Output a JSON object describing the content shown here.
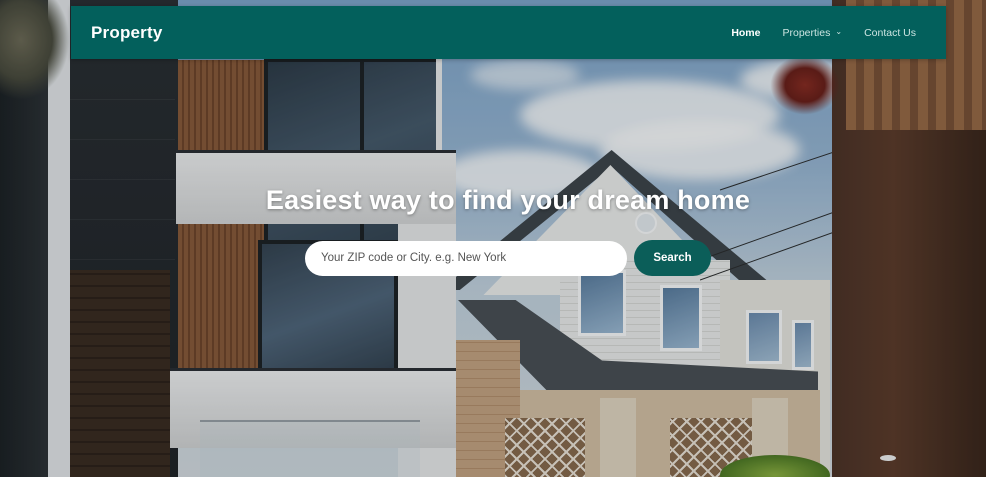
{
  "navbar": {
    "brand": "Property",
    "links": [
      {
        "label": "Home",
        "active": true
      },
      {
        "label": "Properties",
        "dropdown": true,
        "caret_icon": "chevron-down-icon"
      },
      {
        "label": "Contact Us"
      }
    ],
    "background_color": "#03605c"
  },
  "hero": {
    "title": "Easiest way to find your dream home",
    "search": {
      "placeholder": "Your ZIP code or City. e.g. New York",
      "value": "",
      "button_label": "Search"
    },
    "accent_color": "#0b5e59"
  }
}
